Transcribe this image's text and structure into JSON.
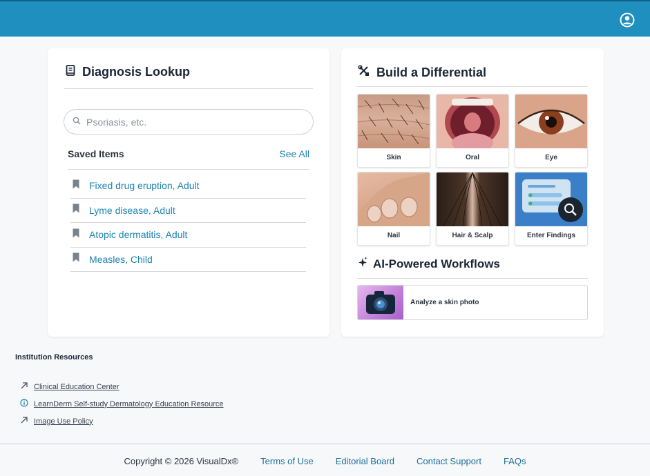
{
  "header": {
    "user_icon": "user-circle-icon",
    "bg_color": "#1f8fbf"
  },
  "lookup": {
    "title": "Diagnosis Lookup",
    "icon": "book-icon",
    "search": {
      "placeholder": "Psoriasis, etc.",
      "value": ""
    },
    "saved_title": "Saved Items",
    "see_all": "See All",
    "saved_items": [
      {
        "label": "Fixed drug eruption, Adult",
        "icon": "bookmark-icon"
      },
      {
        "label": "Lyme disease, Adult",
        "icon": "bookmark-icon"
      },
      {
        "label": "Atopic dermatitis, Adult",
        "icon": "bookmark-icon"
      },
      {
        "label": "Measles, Child",
        "icon": "bookmark-icon"
      }
    ]
  },
  "differential": {
    "title": "Build a Differential",
    "icon": "tools-icon",
    "tiles": [
      {
        "label": "Skin"
      },
      {
        "label": "Oral"
      },
      {
        "label": "Eye"
      },
      {
        "label": "Nail"
      },
      {
        "label": "Hair & Scalp"
      },
      {
        "label": "Enter Findings"
      }
    ]
  },
  "ai": {
    "title": "AI-Powered Workflows",
    "icon": "sparkle-icon",
    "workflows": [
      {
        "label": "Analyze a skin photo",
        "icon": "camera-icon"
      }
    ]
  },
  "resources": {
    "title": "Institution Resources",
    "items": [
      {
        "label": "Clinical Education Center",
        "icon": "external-arrow-icon"
      },
      {
        "label": "LearnDerm Self-study Dermatology Education Resource",
        "icon": "info-icon"
      },
      {
        "label": "Image Use Policy",
        "icon": "external-arrow-icon"
      }
    ]
  },
  "footer": {
    "copyright": "Copyright © 2026 VisualDx®",
    "links": [
      "Terms of Use",
      "Editorial Board",
      "Contact Support",
      "FAQs"
    ]
  }
}
